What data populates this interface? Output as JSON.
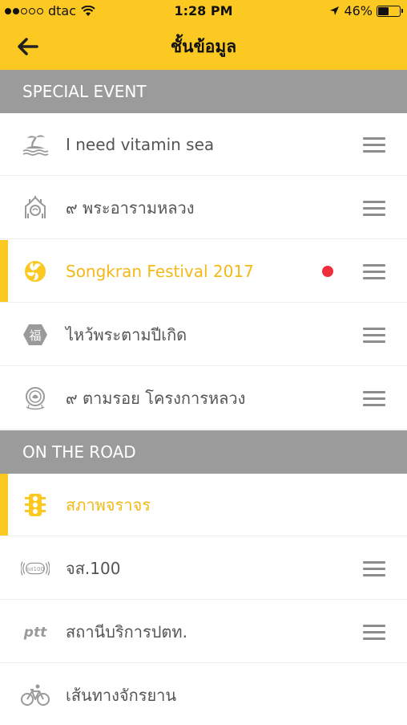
{
  "status_bar": {
    "carrier": "dtac",
    "time": "1:28 PM",
    "battery": "46%",
    "battery_level": 0.46
  },
  "nav": {
    "title": "ชั้นข้อมูล",
    "back_icon": "arrow-left-icon"
  },
  "sections": [
    {
      "title": "SPECIAL EVENT",
      "items": [
        {
          "label": "I need vitamin sea",
          "icon": "island-icon",
          "active": false,
          "handle": true,
          "badge": false
        },
        {
          "label": "๙ พระอารามหลวง",
          "icon": "temple-icon",
          "active": false,
          "handle": true,
          "badge": false
        },
        {
          "label": "Songkran Festival 2017",
          "icon": "songkran-icon",
          "active": true,
          "handle": true,
          "badge": true
        },
        {
          "label": "ไหว้พระตามปีเกิด",
          "icon": "fu-hexagon-icon",
          "active": false,
          "handle": true,
          "badge": false
        },
        {
          "label": "๙ ตามรอย โครงการหลวง",
          "icon": "royal-project-icon",
          "active": false,
          "handle": true,
          "badge": false
        }
      ]
    },
    {
      "title": "ON THE ROAD",
      "items": [
        {
          "label": "สภาพจราจร",
          "icon": "traffic-light-icon",
          "active": true,
          "handle": false,
          "badge": false
        },
        {
          "label": "จส.100",
          "icon": "js100-radio-icon",
          "active": false,
          "handle": true,
          "badge": false
        },
        {
          "label": "สถานีบริการปตท.",
          "icon": "ptt-logo-icon",
          "active": false,
          "handle": true,
          "badge": false
        },
        {
          "label": "เส้นทางจักรยาน",
          "icon": "bicycle-icon",
          "active": false,
          "handle": false,
          "badge": false
        }
      ]
    }
  ],
  "icon_text": {
    "fu": "福",
    "js100": "จส100",
    "ptt": "ptt"
  },
  "colors": {
    "accent": "#fbc921",
    "active_text": "#f3b918",
    "section_bg": "#9b9b9b",
    "badge": "#ee2e3b"
  }
}
